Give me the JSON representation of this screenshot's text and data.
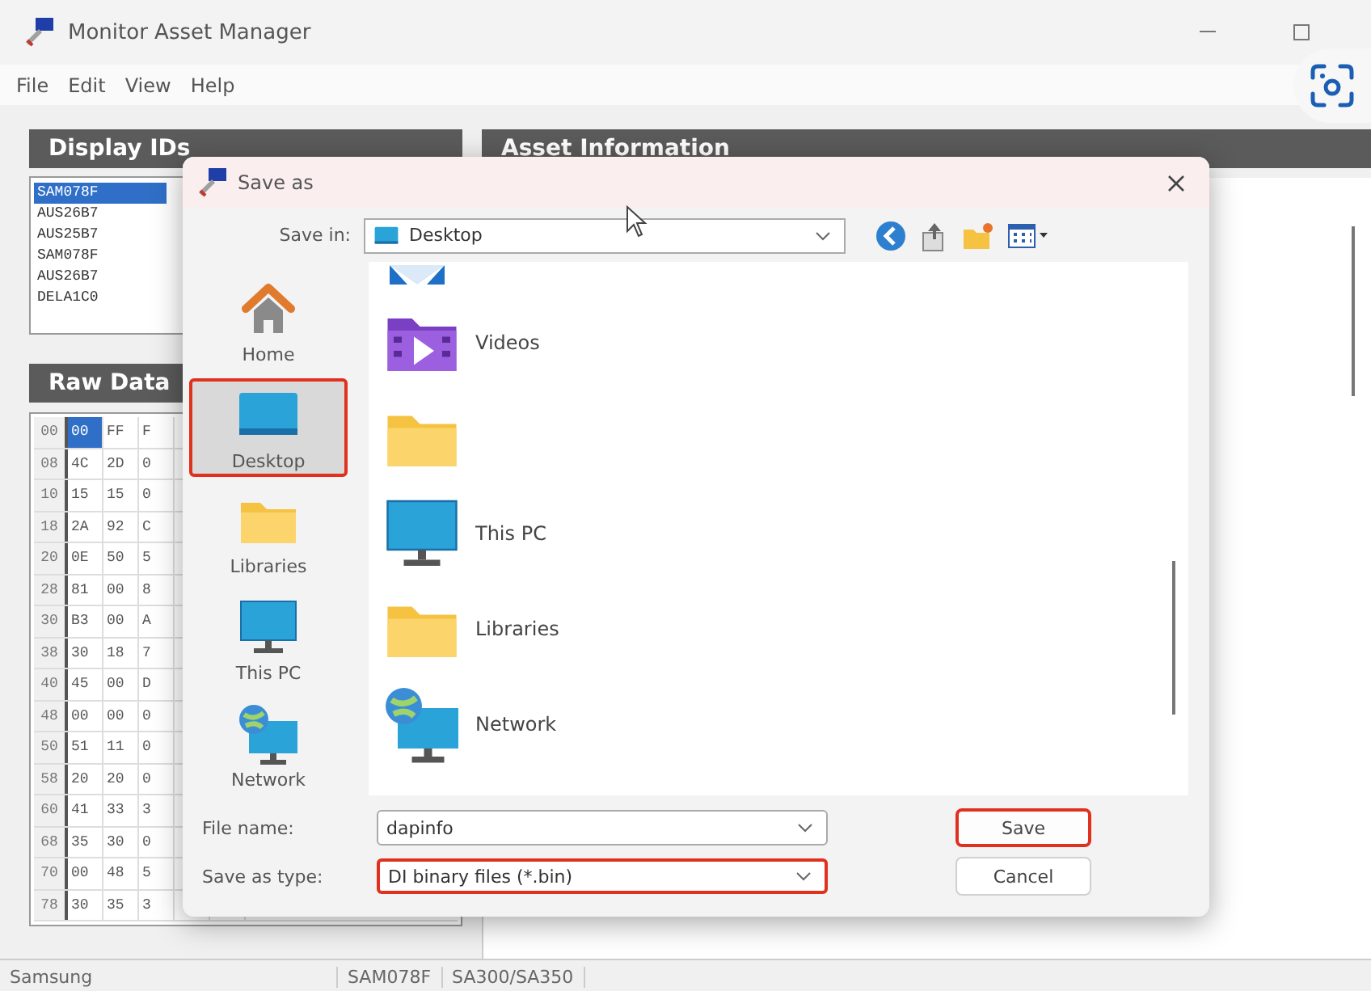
{
  "window": {
    "title": "Monitor Asset Manager"
  },
  "menu": [
    "File",
    "Edit",
    "View",
    "Help"
  ],
  "display_ids": {
    "title": "Display IDs",
    "items": [
      {
        "id": "SAM078F",
        "selected": true
      },
      {
        "id": "AUS26B7",
        "selected": false
      },
      {
        "id": "AUS25B7",
        "selected": false
      },
      {
        "id": "SAM078F",
        "selected": false
      },
      {
        "id": "AUS26B7",
        "selected": false
      },
      {
        "id": "DELA1C0",
        "selected": false
      }
    ]
  },
  "raw_data": {
    "title": "Raw Data",
    "rows": [
      {
        "address": "00",
        "bytes": [
          "00",
          "FF",
          "F"
        ],
        "selected": [
          true,
          false,
          false
        ]
      },
      {
        "address": "08",
        "bytes": [
          "4C",
          "2D",
          "0"
        ],
        "selected": [
          false,
          false,
          false
        ]
      },
      {
        "address": "10",
        "bytes": [
          "15",
          "15",
          "0"
        ],
        "selected": [
          false,
          false,
          false
        ]
      },
      {
        "address": "18",
        "bytes": [
          "2A",
          "92",
          "C"
        ],
        "selected": [
          false,
          false,
          false
        ]
      },
      {
        "address": "20",
        "bytes": [
          "0E",
          "50",
          "5"
        ],
        "selected": [
          false,
          false,
          false
        ]
      },
      {
        "address": "28",
        "bytes": [
          "81",
          "00",
          "8"
        ],
        "selected": [
          false,
          false,
          false
        ]
      },
      {
        "address": "30",
        "bytes": [
          "B3",
          "00",
          "A"
        ],
        "selected": [
          false,
          false,
          false
        ]
      },
      {
        "address": "38",
        "bytes": [
          "30",
          "18",
          "7"
        ],
        "selected": [
          false,
          false,
          false
        ]
      },
      {
        "address": "40",
        "bytes": [
          "45",
          "00",
          "D"
        ],
        "selected": [
          false,
          false,
          false
        ]
      },
      {
        "address": "48",
        "bytes": [
          "00",
          "00",
          "0"
        ],
        "selected": [
          false,
          false,
          false
        ]
      },
      {
        "address": "50",
        "bytes": [
          "51",
          "11",
          "0"
        ],
        "selected": [
          false,
          false,
          false
        ]
      },
      {
        "address": "58",
        "bytes": [
          "20",
          "20",
          "0"
        ],
        "selected": [
          false,
          false,
          false
        ]
      },
      {
        "address": "60",
        "bytes": [
          "41",
          "33",
          "3"
        ],
        "selected": [
          false,
          false,
          false
        ]
      },
      {
        "address": "68",
        "bytes": [
          "35",
          "30",
          "0"
        ],
        "selected": [
          false,
          false,
          false
        ]
      },
      {
        "address": "70",
        "bytes": [
          "00",
          "48",
          "5"
        ],
        "selected": [
          false,
          false,
          false
        ]
      },
      {
        "address": "78",
        "bytes": [
          "30",
          "35",
          "3"
        ],
        "selected": [
          false,
          false,
          false
        ]
      }
    ]
  },
  "asset_information": {
    "title": "Asset Information"
  },
  "status_bar": [
    "Samsung",
    "SAM078F",
    "SA300/SA350"
  ],
  "save_dialog": {
    "title": "Save as",
    "save_in": {
      "label": "Save in:",
      "value": "Desktop"
    },
    "places": [
      {
        "kind": "home",
        "label": "Home",
        "selected": false,
        "highlighted": false
      },
      {
        "kind": "desktop",
        "label": "Desktop",
        "selected": true,
        "highlighted": true
      },
      {
        "kind": "libraries",
        "label": "Libraries",
        "selected": false,
        "highlighted": false
      },
      {
        "kind": "pc",
        "label": "This PC",
        "selected": false,
        "highlighted": false
      },
      {
        "kind": "network",
        "label": "Network",
        "selected": false,
        "highlighted": false
      }
    ],
    "files": [
      {
        "kind": "pictures"
      },
      {
        "kind": "videos",
        "label": "Videos"
      },
      {
        "kind": "folder"
      },
      {
        "kind": "pc",
        "label": "This PC"
      },
      {
        "kind": "libraries",
        "label": "Libraries"
      },
      {
        "kind": "network",
        "label": "Network"
      }
    ],
    "file_name": {
      "label": "File name:",
      "value": "dapinfo"
    },
    "save_type": {
      "label": "Save as type:",
      "value": "DI binary files (*.bin)",
      "highlighted": true
    },
    "buttons": [
      {
        "kind": "save",
        "label": "Save",
        "highlighted": true
      },
      {
        "kind": "cancel",
        "label": "Cancel",
        "highlighted": false
      }
    ]
  }
}
